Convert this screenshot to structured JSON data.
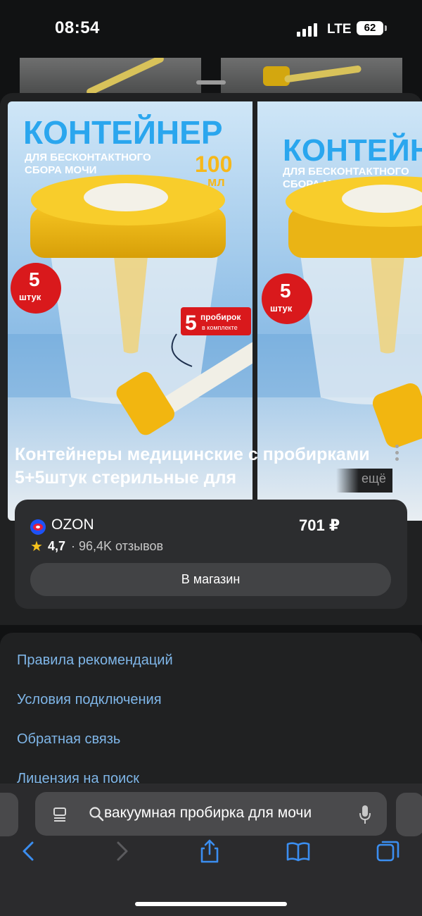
{
  "status_bar": {
    "time": "08:54",
    "network": "LTE",
    "battery": "62"
  },
  "product": {
    "title": "Контейнеры медицинские с пробирками 5+5штук стерильные для",
    "more_label": "ещё",
    "image_text": {
      "headline": "КОНТЕЙНЕР",
      "subtitle_1": "ДЛЯ БЕСКОНТАКТНОГО",
      "subtitle_2": "СБОРА МОЧИ",
      "volume_num": "100",
      "volume_unit": "мл",
      "count_num": "5",
      "count_unit": "штук",
      "tubes_num": "5",
      "tubes_1": "пробирок",
      "tubes_2": "в комплекте"
    }
  },
  "offer": {
    "shop": "OZON",
    "price": "701 ₽",
    "rating": "4,7",
    "reviews": "· 96,4K отзывов",
    "button": "В магазин"
  },
  "footer_links": [
    "Правила рекомендаций",
    "Условия подключения",
    "Обратная связь",
    "Лицензия на поиск"
  ],
  "browser": {
    "url_text": "вакуумная пробирка для мочи"
  }
}
